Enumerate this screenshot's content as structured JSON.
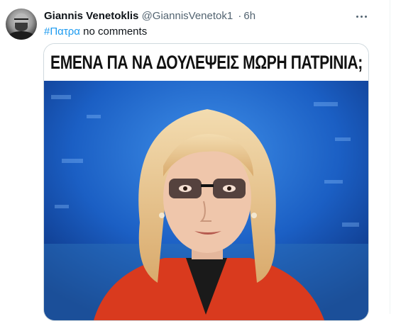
{
  "tweet": {
    "author_name": "Giannis Venetoklis",
    "handle": "@GiannisVenetok1",
    "separator": "·",
    "time": "6h",
    "hashtag": "#Πατρα",
    "text": "no comments",
    "more_icon": "more-horizontal-icon"
  },
  "media": {
    "caption": "ΕΜΕΝΑ ΠΑ ΝΑ ΔΟΥΛΕΨΕΙΣ ΜΩΡΗ ΠΑΤΡΙΝΙΑ;",
    "colors": {
      "background_blue": "#1b5fc4",
      "jacket_red": "#d93a1e",
      "hair_blonde": "#e8c48e"
    }
  },
  "colors": {
    "text": "#0f1419",
    "secondary": "#536471",
    "link": "#1d9bf0",
    "border": "#cfd9de"
  }
}
